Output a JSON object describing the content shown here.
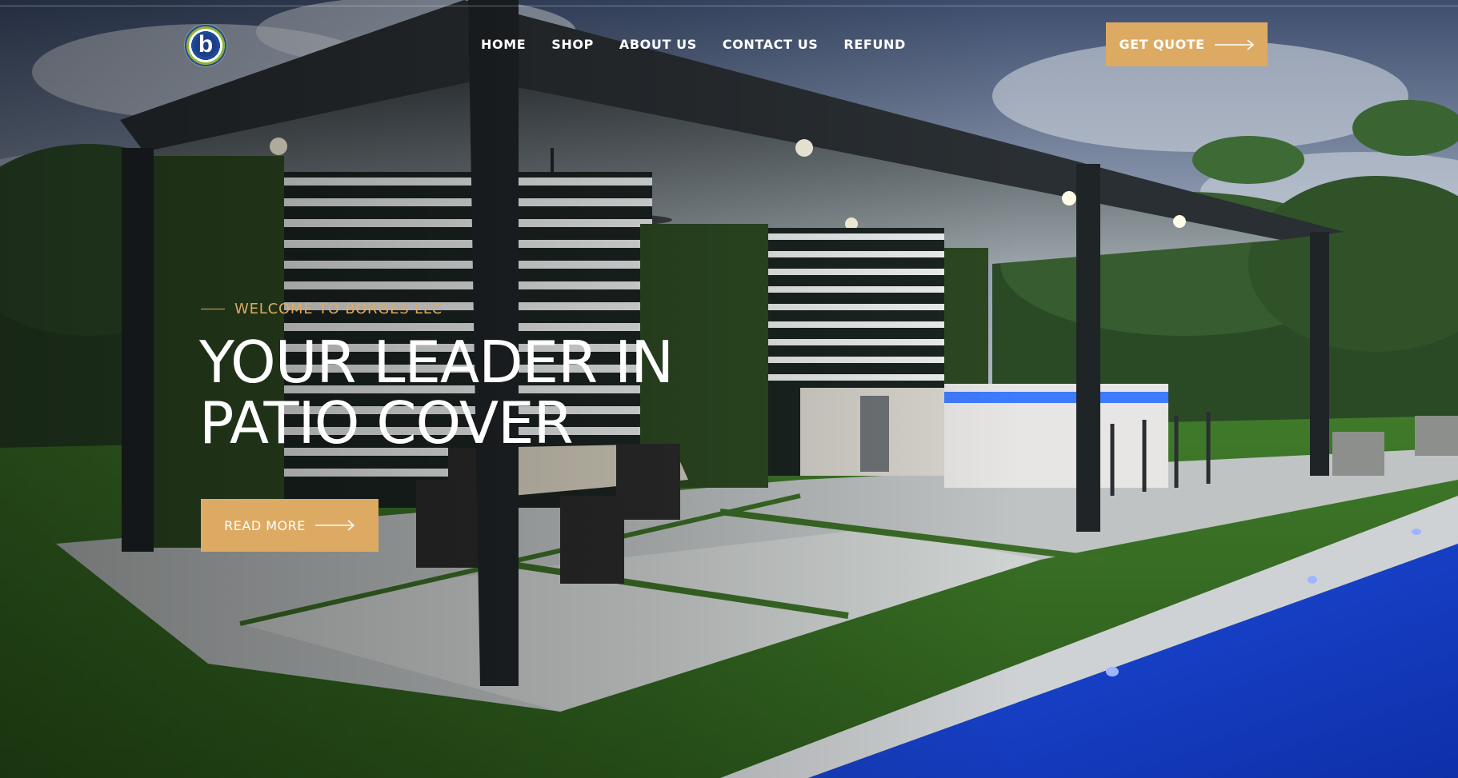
{
  "brand": {
    "logo_icon": "borges-logo-b-icon",
    "accent_color": "#ddaa63"
  },
  "nav": {
    "items": [
      "HOME",
      "SHOP",
      "ABOUT US",
      "CONTACT US",
      "REFUND"
    ]
  },
  "header": {
    "quote_label": "GET QUOTE",
    "quote_icon": "long-arrow-right-icon"
  },
  "hero": {
    "eyebrow": "WELCOME TO BORGES LLC",
    "headline_line1": "YOUR LEADER IN",
    "headline_line2": "PATIO COVER",
    "cta_label": "READ MORE",
    "cta_icon": "long-arrow-right-icon",
    "background_image": "patio-pergola-photo"
  }
}
